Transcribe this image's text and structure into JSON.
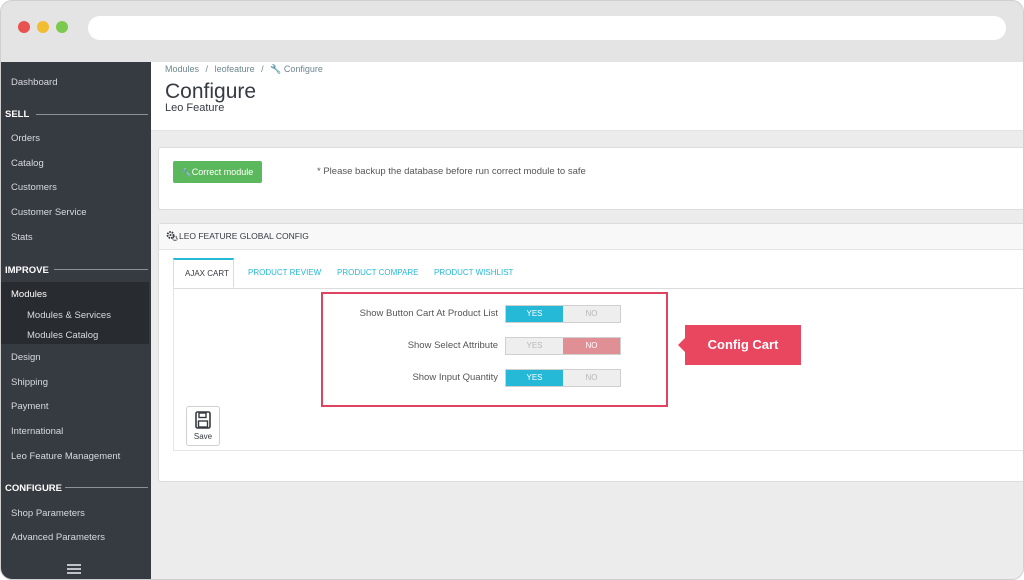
{
  "colors": {
    "accent": "#25b9d7",
    "sidebar": "#363a41",
    "success": "#5cb85c",
    "danger": "#e08f95",
    "callout": "#e8475f"
  },
  "sidebar": {
    "dashboard": "Dashboard",
    "sell": "SELL",
    "orders": "Orders",
    "catalog": "Catalog",
    "customers": "Customers",
    "customer_service": "Customer Service",
    "stats": "Stats",
    "improve": "IMPROVE",
    "modules": "Modules",
    "modules_services": "Modules & Services",
    "modules_catalog": "Modules Catalog",
    "design": "Design",
    "shipping": "Shipping",
    "payment": "Payment",
    "international": "International",
    "leo_feature": "Leo Feature Management",
    "configure": "CONFIGURE",
    "shop_params": "Shop Parameters",
    "advanced_params": "Advanced Parameters"
  },
  "header": {
    "crumb1": "Modules",
    "crumb2": "leofeature",
    "crumb3": "Configure",
    "sep": "/",
    "title": "Configure",
    "subtitle": "Leo Feature"
  },
  "panel1": {
    "button": "Correct module",
    "notice": "* Please backup the database before run correct module to safe"
  },
  "panel2": {
    "title": "LEO FEATURE GLOBAL CONFIG",
    "tabs": [
      "AJAX CART",
      "PRODUCT REVIEW",
      "PRODUCT COMPARE",
      "PRODUCT WISHLIST"
    ],
    "rows": [
      {
        "label": "Show Button Cart At Product List",
        "yes": "YES",
        "no": "NO",
        "value": "YES"
      },
      {
        "label": "Show Select Attribute",
        "yes": "YES",
        "no": "NO",
        "value": "NO"
      },
      {
        "label": "Show Input Quantity",
        "yes": "YES",
        "no": "NO",
        "value": "YES"
      }
    ],
    "save": "Save"
  },
  "callout": "Config Cart"
}
